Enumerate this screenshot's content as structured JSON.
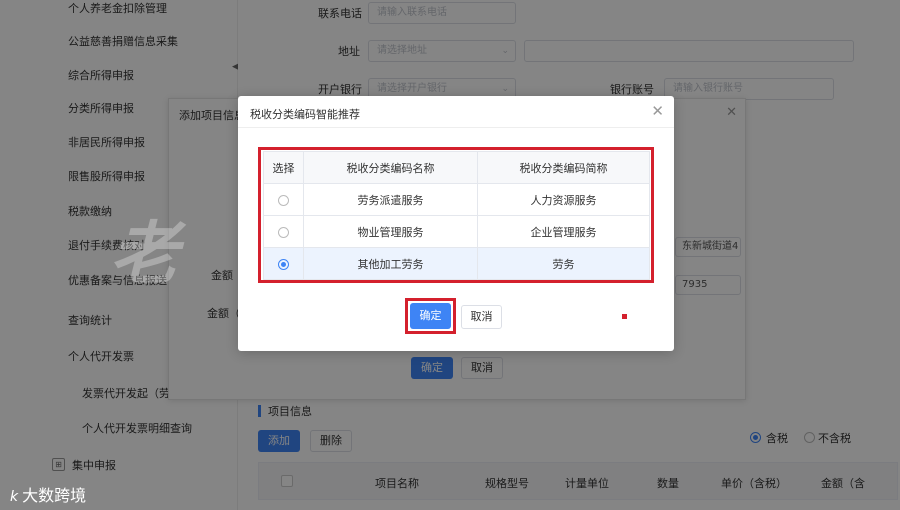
{
  "sidebar": {
    "items": [
      {
        "label": "个人养老金扣除管理"
      },
      {
        "label": "公益慈善捐赠信息采集"
      },
      {
        "label": "综合所得申报"
      },
      {
        "label": "分类所得申报"
      },
      {
        "label": "非居民所得申报"
      },
      {
        "label": "限售股所得申报"
      },
      {
        "label": "税款缴纳"
      },
      {
        "label": "退付手续费核对"
      },
      {
        "label": "优惠备案与信息报送"
      },
      {
        "label": "查询统计"
      },
      {
        "label": "个人代开发票"
      }
    ],
    "subitems": [
      {
        "label": "发票代开发起（劳务"
      },
      {
        "label": "个人代开发票明细查询"
      }
    ],
    "group": {
      "label": "集中申报"
    }
  },
  "form": {
    "phone_label": "联系电话",
    "phone_placeholder": "请输入联系电话",
    "address_label": "地址",
    "address_placeholder": "请选择地址",
    "bank_label": "开户银行",
    "bank_placeholder": "请选择开户银行",
    "account_label": "银行账号",
    "account_placeholder": "请输入银行账号"
  },
  "inner_dialog": {
    "title": "添加项目信息",
    "amount_tax_label": "金额",
    "amount_label": "金额（",
    "address_value": "东新城街道4",
    "number_value": "7935",
    "confirm_label": "确定",
    "cancel_label": "取消"
  },
  "items_section": {
    "title": "项目信息",
    "add_label": "添加",
    "delete_label": "删除",
    "tax_included_label": "含税",
    "tax_excluded_label": "不含税",
    "columns": [
      "项目名称",
      "规格型号",
      "计量单位",
      "数量",
      "单价（含税）",
      "金额（含"
    ]
  },
  "modal": {
    "title": "税收分类编码智能推荐",
    "columns": [
      "选择",
      "税收分类编码名称",
      "税收分类编码简称"
    ],
    "rows": [
      {
        "name": "劳务派遣服务",
        "short": "人力资源服务",
        "selected": false
      },
      {
        "name": "物业管理服务",
        "short": "企业管理服务",
        "selected": false
      },
      {
        "name": "其他加工劳务",
        "short": "劳务",
        "selected": true
      }
    ],
    "confirm_label": "确定",
    "cancel_label": "取消"
  },
  "watermark": "老 鹰 跨 境",
  "logo": {
    "mark": "k",
    "text": "大数跨境"
  },
  "colors": {
    "primary": "#3e84f5",
    "highlight": "#d4202d"
  }
}
